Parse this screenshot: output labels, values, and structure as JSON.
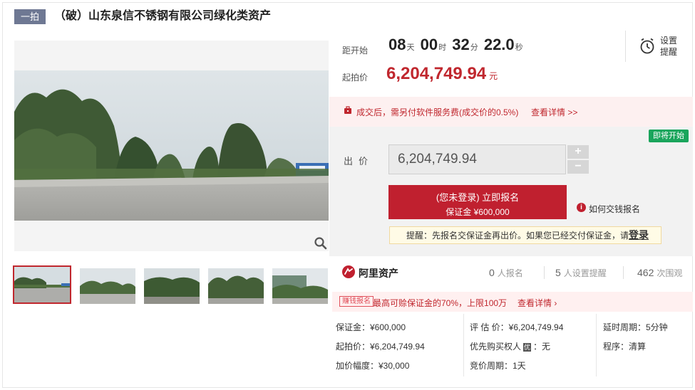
{
  "header": {
    "tag": "一拍",
    "title": "（破）山东泉信不锈钢有限公司绿化类资产"
  },
  "countdown": {
    "label": "距开始",
    "days": "08",
    "days_unit": "天",
    "hours": "00",
    "hours_unit": "时",
    "minutes": "32",
    "minutes_unit": "分",
    "seconds": "22.0",
    "seconds_unit": "秒"
  },
  "start_price": {
    "label": "起拍价",
    "value": "6,204,749.94",
    "unit": "元"
  },
  "reminder": {
    "line1": "设置",
    "line2": "提醒",
    "icon": "alarm-clock-icon"
  },
  "fee_notice": {
    "text": "成交后，需另付软件服务费(成交价的0.5%)",
    "link": "查看详情 >>"
  },
  "bid": {
    "status_badge": "即将开始",
    "label": "出价",
    "input_value": "6,204,749.94",
    "plus": "+",
    "minus": "−",
    "signup_main": "(您未登录) 立即报名",
    "signup_sub": "保证金 ¥600,000",
    "howto_link": "如何交钱报名",
    "tip_text": "提醒：先报名交保证金再出价。如果您已经交付保证金，请",
    "tip_login": "登录"
  },
  "stats": {
    "brand": "阿里资产",
    "signups_num": "0",
    "signups_label": "人报名",
    "reminders_num": "5",
    "reminders_label": "人设置提醒",
    "views_num": "462",
    "views_label": "次围观"
  },
  "promo": {
    "badge": "赚钱报名",
    "text": "最高可赊保证金的70%，上限100万",
    "link": "查看详情 ›"
  },
  "details": {
    "deposit": "保证金：¥600,000",
    "start_price": "起拍价：¥6,204,749.94",
    "increment": "加价幅度：¥30,000",
    "appraisal": "评 估 价：¥6,204,749.94",
    "priority_prefix": "优先购买权人",
    "priority_badge": "优",
    "priority_value": "：无",
    "bid_cycle": "竞价周期：1天",
    "extension": "延时周期：5分钟",
    "procedure": "程序：清算"
  },
  "colors": {
    "accent_red": "#c0202f",
    "tag_gray": "#6e7893",
    "badge_green": "#1aa55c"
  }
}
